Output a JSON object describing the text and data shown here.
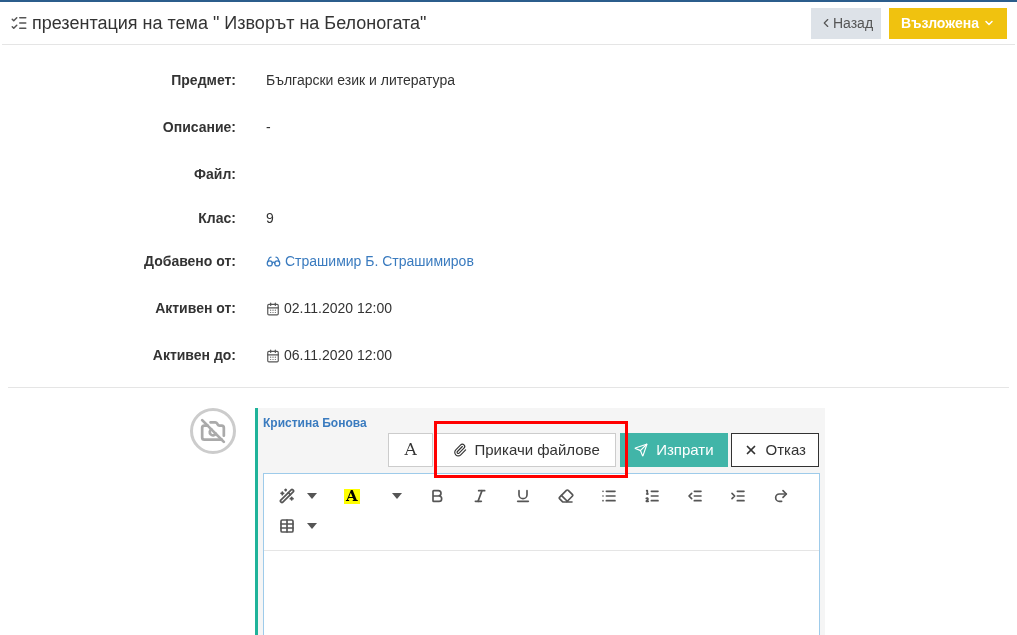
{
  "header": {
    "title": "презентация на тема \" Изворът на Белоногата\"",
    "back": "Назад",
    "status": "Възложена"
  },
  "fields": [
    {
      "label": "Предмет:",
      "kind": "text",
      "value": "Български език и литература"
    },
    {
      "label": "Описание:",
      "kind": "text",
      "value": "-"
    },
    {
      "label": "Файл:",
      "kind": "empty"
    },
    {
      "label": "Клас:",
      "kind": "text",
      "value": "9"
    },
    {
      "label": "Добавено от:",
      "kind": "person",
      "value": "Страшимир Б. Страшимиров"
    },
    {
      "label": "Активен от:",
      "kind": "date",
      "value": "02.11.2020 12:00"
    },
    {
      "label": "Активен до:",
      "kind": "date",
      "value": "06.11.2020 12:00"
    }
  ],
  "comment": {
    "author": "Кристина Бонова",
    "font_button": "A",
    "attach": "Прикачи файлове",
    "send": "Изпрати",
    "cancel": "Отказ",
    "highlight_mark": "A",
    "toolbar": [
      {
        "kind": "magic"
      },
      {
        "kind": "highlight"
      },
      {
        "kind": "bold"
      },
      {
        "kind": "italic"
      },
      {
        "kind": "underline"
      },
      {
        "kind": "eraser"
      },
      {
        "kind": "bullets"
      },
      {
        "kind": "numbers"
      },
      {
        "kind": "outdent"
      },
      {
        "kind": "indent"
      },
      {
        "kind": "redo"
      },
      {
        "kind": "table"
      }
    ]
  }
}
